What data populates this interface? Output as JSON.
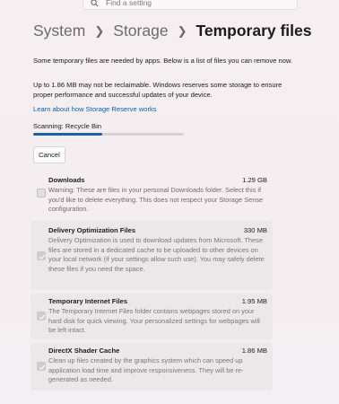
{
  "search": {
    "placeholder": "Find a setting"
  },
  "breadcrumb": {
    "items": [
      "System",
      "Storage"
    ],
    "current": "Temporary files"
  },
  "intro": {
    "line1": "Some temporary files are needed by apps. Below is a list of files you can remove now.",
    "line2": "Up to 1.86 MB may not be reclaimable. Windows reserves some storage to ensure proper performance and successful updates of your device."
  },
  "learn_link": "Learn about how Storage Reserve works",
  "scan": {
    "label": "Scanning: Recycle Bin",
    "progress": 0.46
  },
  "cancel_label": "Cancel",
  "accent": "#1d5fa8",
  "categories": [
    {
      "title": "Downloads",
      "size": "1.29 GB",
      "checked": false,
      "description": "Warning: These are files in your personal Downloads folder. Select this if you'd like to delete everything. This does not respect your Storage Sense configuration."
    },
    {
      "title": "Delivery Optimization Files",
      "size": "330 MB",
      "checked": true,
      "description": "Delivery Optimization is used to download updates from Microsoft. These files are stored in a dedicated cache to be uploaded to other devices on your local network (if your settings allow such use). You may safely delete these files if you need the space."
    },
    {
      "title": "Temporary Internet Files",
      "size": "1.95 MB",
      "checked": true,
      "description": "The Temporary Internet Files folder contains webpages stored on your hard disk for quick viewing. Your personalized settings for webpages will be left intact."
    },
    {
      "title": "DirectX Shader Cache",
      "size": "1.86 MB",
      "checked": true,
      "description": "Clean up files created by the graphics system which can speed up application load time and improve responsiveness. They will be re-generated as needed."
    }
  ]
}
